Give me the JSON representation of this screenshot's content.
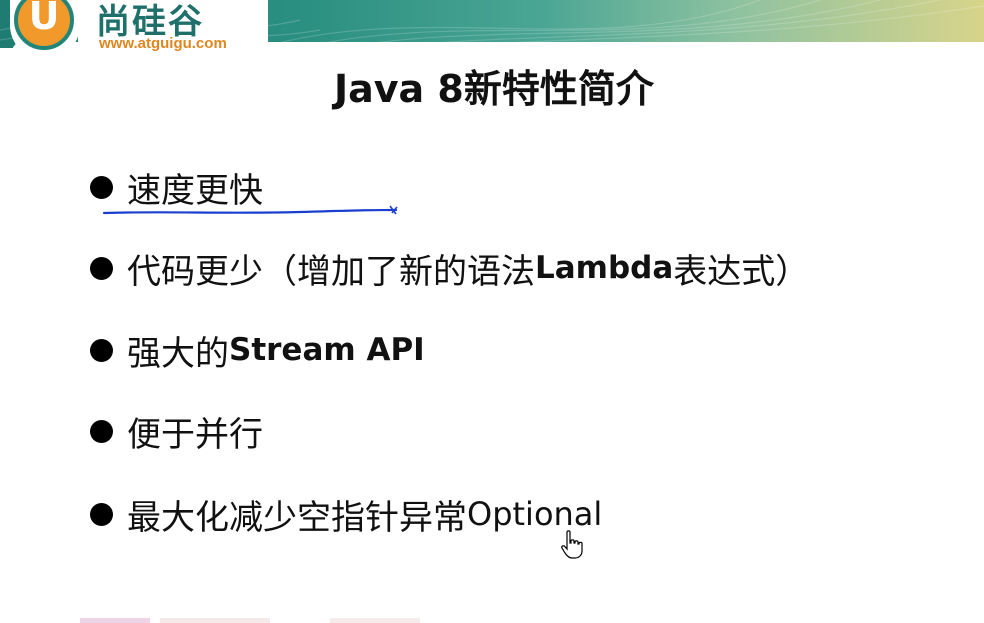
{
  "logo": {
    "mark": "U",
    "name_cn": "尚硅谷",
    "url": "www.atguigu.com"
  },
  "title": "Java 8新特性简介",
  "bullets": [
    {
      "text": "速度更快"
    },
    {
      "text": "代码更少（增加了新的语法 ",
      "strong": "Lambda",
      "after": " 表达式）"
    },
    {
      "text": "强大的 ",
      "strong": "Stream API"
    },
    {
      "text": "便于并行"
    },
    {
      "text": "最大化减少空指针异常 ",
      "plain": "Optional"
    }
  ],
  "colors": {
    "banner_teal": "#1f7c72",
    "logo_orange": "#f19a2b",
    "annotation_blue": "#1a3fd0"
  },
  "icons": {
    "bullet": "filled-circle",
    "cursor": "hand-pointer-icon"
  }
}
